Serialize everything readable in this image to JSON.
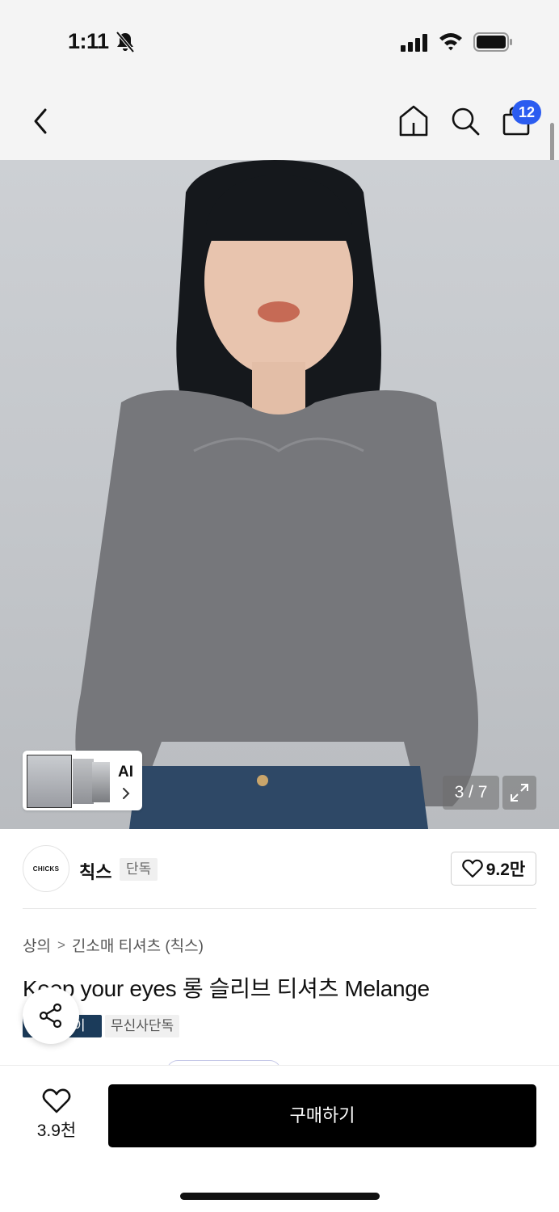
{
  "status": {
    "time": "1:11"
  },
  "nav": {
    "cart_count": "12"
  },
  "gallery": {
    "counter": "3 / 7",
    "ai_label": "AI"
  },
  "brand": {
    "name": "칙스",
    "logo_text": "CHICKS",
    "tag": "단독",
    "likes": "9.2만"
  },
  "product": {
    "breadcrumb": [
      "상의",
      "긴소매 티셔츠 (칙스)"
    ],
    "title": "Keep your eyes 롱 슬리브 티셔츠 Melange",
    "tags": [
      "이",
      "무신사단독"
    ]
  },
  "bottom": {
    "likes": "3.9천",
    "buy_label": "구매하기"
  },
  "icons": [
    "bell-slash-icon",
    "signal-icon",
    "wifi-icon",
    "battery-icon",
    "back-arrow-icon",
    "home-icon",
    "search-icon",
    "bag-icon",
    "expand-icon",
    "chevron-right-icon",
    "heart-icon",
    "share-icon"
  ],
  "colors": {
    "badge": "#2b5cf0",
    "buy_button": "#000000",
    "tag_blue": "#1b3b5a"
  }
}
